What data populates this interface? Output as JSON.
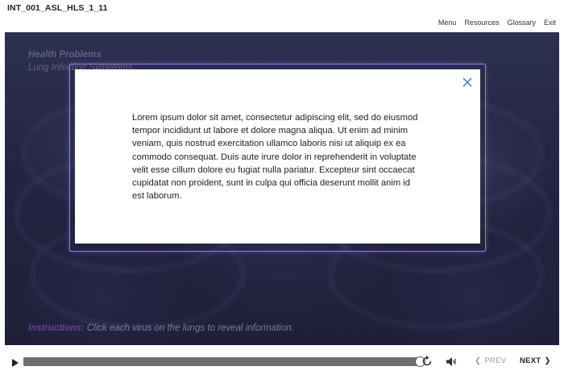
{
  "header": {
    "course_id": "INT_001_ASL_HLS_1_11",
    "nav": [
      "Menu",
      "Resources",
      "Glossary",
      "Exit"
    ]
  },
  "slide": {
    "title": "Health Problems",
    "subtitle": "Lung Infection Symptoms",
    "instructions_lead": "Instructions:",
    "instructions_text": "Click each virus on the lungs to reveal information."
  },
  "modal": {
    "close_icon": "close-icon",
    "body": "Lorem ipsum dolor sit amet, consectetur adipiscing elit, sed do eiusmod tempor incididunt ut labore et dolore magna aliqua. Ut enim ad minim veniam, quis nostrud exercitation ullamco laboris nisi ut aliquip ex ea commodo consequat. Duis aute irure dolor in reprehenderit in voluptate velit esse cillum dolore eu fugiat nulla pariatur. Excepteur sint occaecat cupidatat non proident, sunt in culpa qui officia deserunt mollit anim id est laborum."
  },
  "player": {
    "progress_fraction": 1.0,
    "prev_label": "PREV",
    "next_label": "NEXT",
    "icons": [
      "play-icon",
      "replay-icon",
      "volume-icon",
      "chevron-left-icon",
      "chevron-right-icon"
    ]
  },
  "colors": {
    "stage_bg": "#232441",
    "modal_border": "#8a7fe0",
    "close_icon": "#4a8ad4",
    "instructions_lead": "#6b3e9e"
  }
}
